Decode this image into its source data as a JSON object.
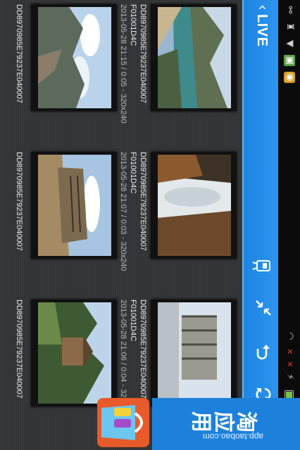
{
  "status": {
    "clock": "2"
  },
  "action_bar": {
    "title": "LIVE",
    "back_icon": "chevron-left-icon",
    "actions": [
      {
        "name": "camera-icon"
      },
      {
        "name": "collapse-arrows-icon"
      },
      {
        "name": "undo-icon"
      },
      {
        "name": "refresh-icon"
      }
    ]
  },
  "items": [
    {
      "name": "DD8970985E79237E040007",
      "name2": "F01001D4C",
      "info": "2013-05-28 21:15 / 0:05 - 320x240"
    },
    {
      "name": "DD8970985E79237E040007",
      "name2": "",
      "info": ""
    },
    {
      "name": "DD8970985E79237E040007",
      "name2": "F01001D4C",
      "info": "2013-05-28 21:07 / 0:03 - 320x240"
    },
    {
      "name": "DD8970985E79237E040007",
      "name2": "",
      "info": ""
    },
    {
      "name": "DD8970985E79237E040007",
      "name2": "F01001D4C",
      "info": "2013-05-28 21:06 / 0:04 - 320x240"
    },
    {
      "name": "DD8970985E79237E040007",
      "name2": "",
      "info": ""
    }
  ],
  "ad": {
    "brand": "淘应用",
    "url": "app.taobao.com",
    "badge": "APP"
  },
  "colors": {
    "action_bar": "#1f85e2",
    "background": "#333436"
  }
}
